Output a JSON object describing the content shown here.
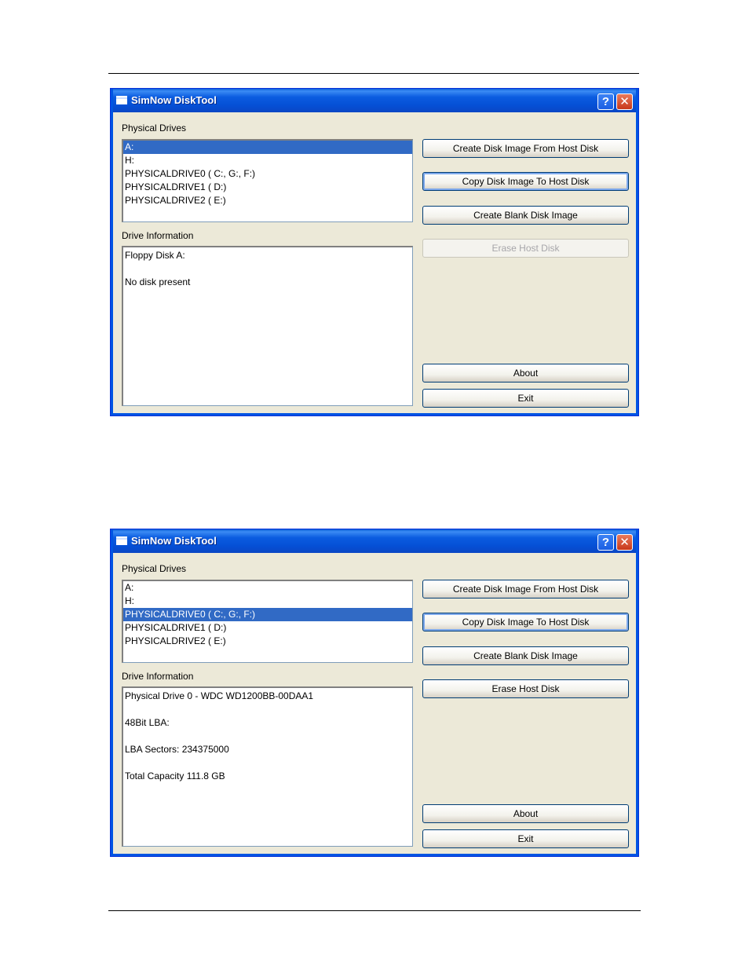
{
  "windows": [
    {
      "title": "SimNow DiskTool",
      "help_glyph": "?",
      "close_glyph": "✕",
      "physical_drives_label": "Physical Drives",
      "drives": [
        "A:",
        "H:",
        "PHYSICALDRIVE0 ( C:, G:, F:)",
        "PHYSICALDRIVE1 ( D:)",
        "PHYSICALDRIVE2 ( E:)"
      ],
      "selected_index": 0,
      "drive_info_label": "Drive Information",
      "drive_info": [
        "Floppy Disk A:",
        "",
        "No disk present"
      ],
      "buttons": {
        "create_from_host": "Create Disk Image From Host Disk",
        "copy_to_host": "Copy Disk Image To Host Disk",
        "create_blank": "Create Blank Disk Image",
        "erase": "Erase Host Disk",
        "about": "About",
        "exit": "Exit"
      },
      "erase_enabled": false
    },
    {
      "title": "SimNow DiskTool",
      "help_glyph": "?",
      "close_glyph": "✕",
      "physical_drives_label": "Physical Drives",
      "drives": [
        "A:",
        "H:",
        "PHYSICALDRIVE0 ( C:, G:, F:)",
        "PHYSICALDRIVE1 ( D:)",
        "PHYSICALDRIVE2 ( E:)"
      ],
      "selected_index": 2,
      "drive_info_label": "Drive Information",
      "drive_info": [
        "Physical Drive 0 - WDC WD1200BB-00DAA1",
        "",
        "48Bit LBA:",
        "",
        "LBA Sectors: 234375000",
        "",
        "Total Capacity 111.8 GB"
      ],
      "buttons": {
        "create_from_host": "Create Disk Image From Host Disk",
        "copy_to_host": "Copy Disk Image To Host Disk",
        "create_blank": "Create Blank Disk Image",
        "erase": "Erase Host Disk",
        "about": "About",
        "exit": "Exit"
      },
      "erase_enabled": true
    }
  ]
}
